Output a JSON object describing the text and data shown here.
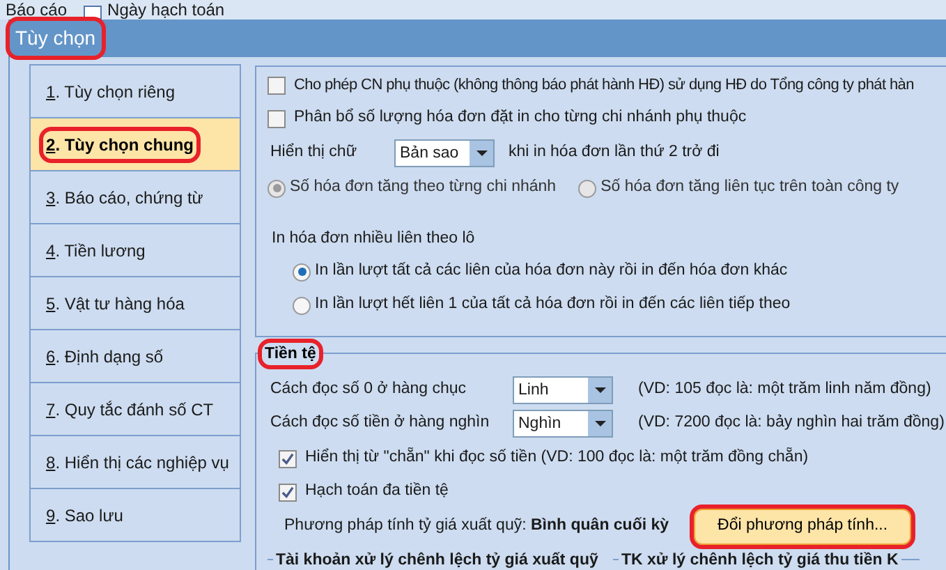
{
  "menu_bar": [
    {
      "label": "Báo cáo"
    },
    {
      "label": "Ngày hạch toán"
    }
  ],
  "window": {
    "title": "Tùy chọn",
    "annotated": true
  },
  "sidebar": {
    "items": [
      {
        "number": "1",
        "label": ". Tùy chọn riêng",
        "selected": false,
        "annotated": false
      },
      {
        "number": "2",
        "label": ". Tùy chọn chung",
        "selected": true,
        "annotated": true
      },
      {
        "number": "3",
        "label": ". Báo cáo, chứng từ",
        "selected": false,
        "annotated": false
      },
      {
        "number": "4",
        "label": ". Tiền lương",
        "selected": false,
        "annotated": false
      },
      {
        "number": "5",
        "label": ". Vật tư hàng hóa",
        "selected": false,
        "annotated": false
      },
      {
        "number": "6",
        "label": ". Định dạng số",
        "selected": false,
        "annotated": false
      },
      {
        "number": "7",
        "label": ". Quy tắc đánh số CT",
        "selected": false,
        "annotated": false
      },
      {
        "number": "8",
        "label": ". Hiển thị các nghiệp vụ",
        "selected": false,
        "annotated": false
      },
      {
        "number": "9",
        "label": ". Sao lưu",
        "selected": false,
        "annotated": false
      }
    ]
  },
  "invoice_group": {
    "checkboxes": [
      {
        "label": "Cho phép CN phụ thuộc (không thông báo phát hành HĐ) sử dụng HĐ do Tổng công ty phát hàn",
        "checked": false
      },
      {
        "label": "Phân bổ số lượng hóa đơn đặt in cho từng chi nhánh phụ thuộc",
        "checked": false
      }
    ],
    "display_text": {
      "label": "Hiển thị chữ",
      "value": "Bản sao",
      "suffix": "khi in hóa đơn lần thứ 2 trở đi"
    },
    "numbering_radios": [
      {
        "label": "Số hóa đơn tăng theo từng chi nhánh",
        "selected": true,
        "disabled": true
      },
      {
        "label": "Số hóa đơn tăng liên tục trên toàn công ty",
        "selected": false,
        "disabled": true
      }
    ],
    "batch_print": {
      "label": "In hóa đơn nhiều liên theo lô",
      "options": [
        {
          "label": "In lần lượt tất cả các liên của hóa đơn này rồi in đến hóa đơn khác",
          "selected": true
        },
        {
          "label": "In lần lượt hết liên 1 của tất cả hóa đơn rồi in đến các liên tiếp theo",
          "selected": false
        }
      ]
    }
  },
  "currency_group": {
    "title": "Tiền tệ",
    "annotated": true,
    "dropdowns": [
      {
        "label": "Cách đọc số 0 ở hàng chục",
        "value": "Linh",
        "example": "(VD: 105 đọc là: một trăm linh năm đồng)"
      },
      {
        "label": "Cách đọc số tiền ở hàng nghìn",
        "value": "Nghìn",
        "example": "(VD: 7200 đọc là: bảy nghìn hai trăm đồng)"
      }
    ],
    "checkboxes": [
      {
        "label": "Hiển thị từ \"chẵn\" khi đọc số tiền (VD: 100 đọc là: một trăm đồng chẵn)",
        "checked": true
      },
      {
        "label": "Hạch toán đa tiền tệ",
        "checked": true
      }
    ],
    "method": {
      "label": "Phương pháp tính tỷ giá xuất quỹ:",
      "value": "Bình quân cuối kỳ"
    },
    "change_button": {
      "label": "Đổi phương pháp tính...",
      "annotated": true
    },
    "subgroups": [
      {
        "title": "Tài khoản xử lý chênh lệch tỷ giá xuất quỹ"
      },
      {
        "title": "TK xử lý chênh lệch tỷ giá thu tiền K"
      }
    ]
  }
}
